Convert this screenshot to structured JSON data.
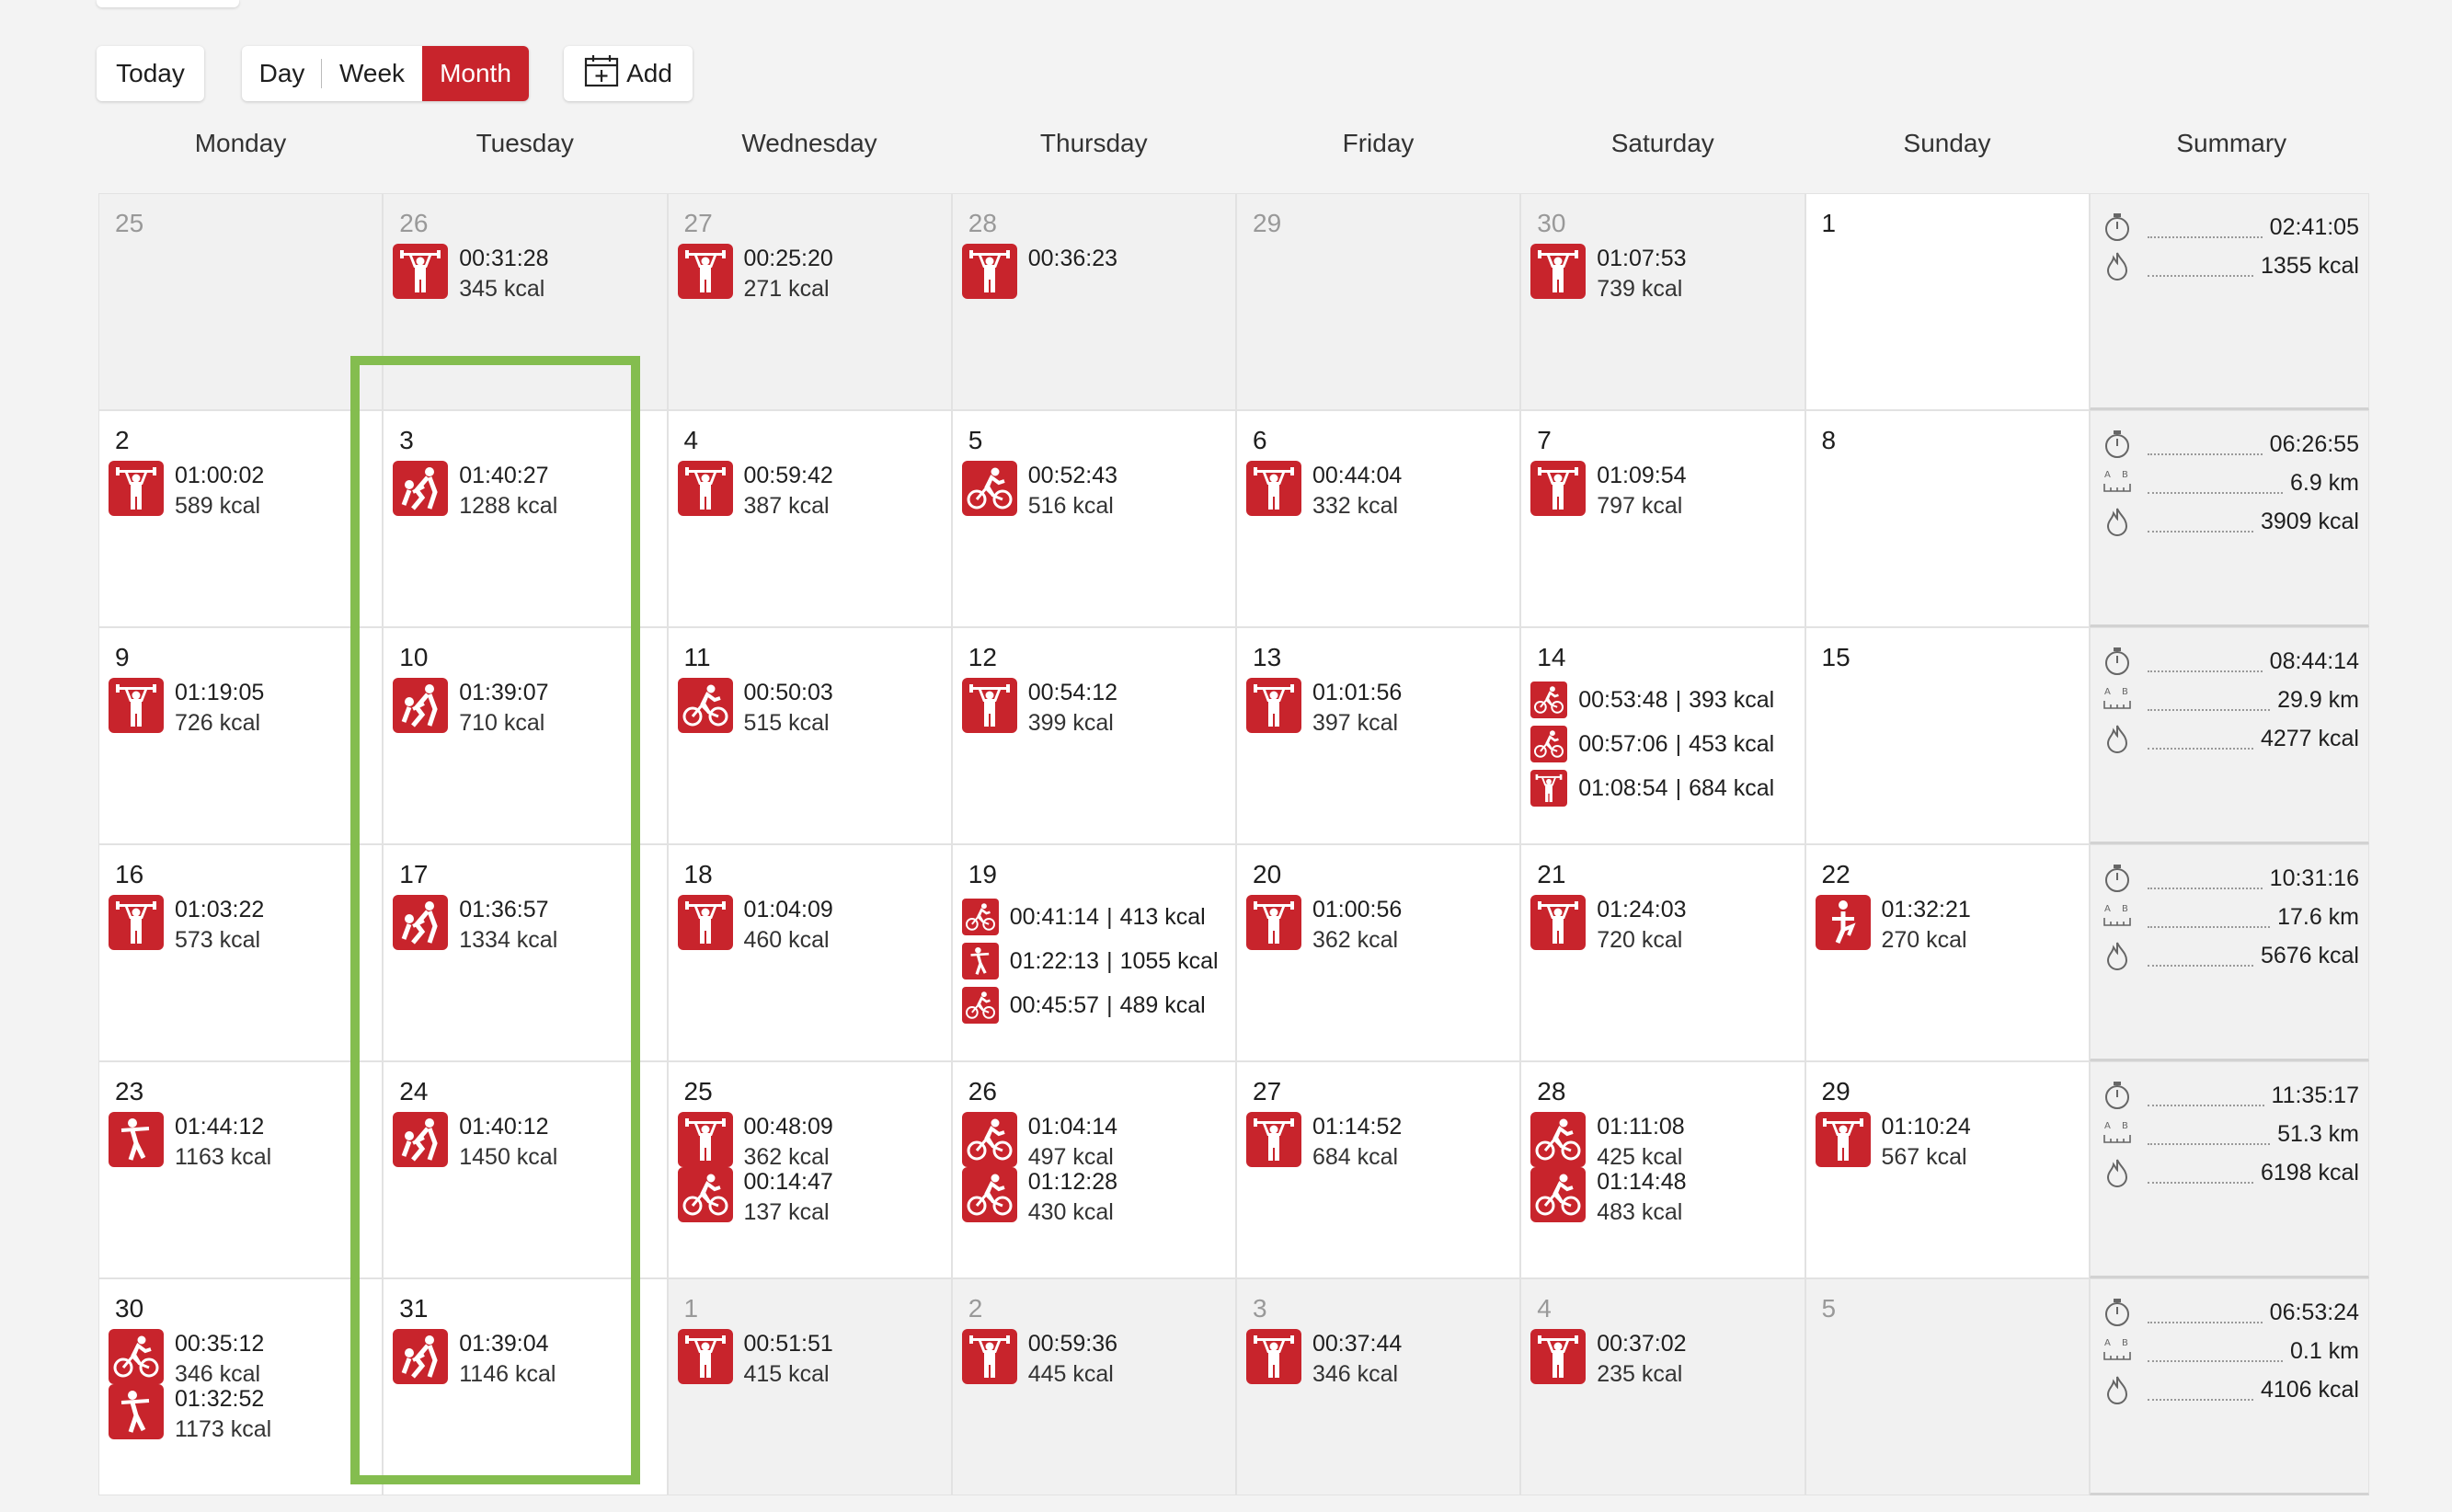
{
  "toolbar": {
    "today_label": "Today",
    "day_label": "Day",
    "week_label": "Week",
    "month_label": "Month",
    "add_label": "Add"
  },
  "weekdays": [
    "Monday",
    "Tuesday",
    "Wednesday",
    "Thursday",
    "Friday",
    "Saturday",
    "Sunday",
    "Summary"
  ],
  "colors": {
    "accent": "#c8242c",
    "highlight": "#84bd4f"
  },
  "weeks": [
    {
      "days": [
        {
          "num": "25",
          "out": true,
          "entries": []
        },
        {
          "num": "26",
          "out": true,
          "entries": [
            {
              "icon": "weightlifting-icon",
              "time": "00:31:28",
              "kcal": "345 kcal"
            }
          ]
        },
        {
          "num": "27",
          "out": true,
          "entries": [
            {
              "icon": "weightlifting-icon",
              "time": "00:25:20",
              "kcal": "271 kcal"
            }
          ]
        },
        {
          "num": "28",
          "out": true,
          "entries": [
            {
              "icon": "weightlifting-icon",
              "time": "00:36:23",
              "kcal": ""
            }
          ]
        },
        {
          "num": "29",
          "out": true,
          "entries": []
        },
        {
          "num": "30",
          "out": true,
          "entries": [
            {
              "icon": "weightlifting-icon",
              "time": "01:07:53",
              "kcal": "739 kcal"
            }
          ]
        },
        {
          "num": "1",
          "out": false,
          "entries": []
        }
      ],
      "summary": {
        "time": "02:41:05",
        "distance": "",
        "kcal": "1355 kcal"
      }
    },
    {
      "days": [
        {
          "num": "2",
          "out": false,
          "entries": [
            {
              "icon": "weightlifting-icon",
              "time": "01:00:02",
              "kcal": "589 kcal"
            }
          ]
        },
        {
          "num": "3",
          "out": false,
          "entries": [
            {
              "icon": "wrestling-icon",
              "time": "01:40:27",
              "kcal": "1288 kcal"
            }
          ]
        },
        {
          "num": "4",
          "out": false,
          "entries": [
            {
              "icon": "weightlifting-icon",
              "time": "00:59:42",
              "kcal": "387 kcal"
            }
          ]
        },
        {
          "num": "5",
          "out": false,
          "entries": [
            {
              "icon": "cycling-icon",
              "time": "00:52:43",
              "kcal": "516 kcal"
            }
          ]
        },
        {
          "num": "6",
          "out": false,
          "entries": [
            {
              "icon": "weightlifting-icon",
              "time": "00:44:04",
              "kcal": "332 kcal"
            }
          ]
        },
        {
          "num": "7",
          "out": false,
          "entries": [
            {
              "icon": "weightlifting-icon",
              "time": "01:09:54",
              "kcal": "797 kcal"
            }
          ]
        },
        {
          "num": "8",
          "out": false,
          "entries": []
        }
      ],
      "summary": {
        "time": "06:26:55",
        "distance": "6.9 km",
        "kcal": "3909 kcal"
      }
    },
    {
      "days": [
        {
          "num": "9",
          "out": false,
          "entries": [
            {
              "icon": "weightlifting-icon",
              "time": "01:19:05",
              "kcal": "726 kcal"
            }
          ]
        },
        {
          "num": "10",
          "out": false,
          "entries": [
            {
              "icon": "wrestling-icon",
              "time": "01:39:07",
              "kcal": "710 kcal"
            }
          ]
        },
        {
          "num": "11",
          "out": false,
          "entries": [
            {
              "icon": "cycling-icon",
              "time": "00:50:03",
              "kcal": "515 kcal"
            }
          ]
        },
        {
          "num": "12",
          "out": false,
          "entries": [
            {
              "icon": "weightlifting-icon",
              "time": "00:54:12",
              "kcal": "399 kcal"
            }
          ]
        },
        {
          "num": "13",
          "out": false,
          "entries": [
            {
              "icon": "weightlifting-icon",
              "time": "01:01:56",
              "kcal": "397 kcal"
            }
          ]
        },
        {
          "num": "14",
          "out": false,
          "compact": true,
          "entries": [
            {
              "icon": "cycling-icon",
              "time": "00:53:48",
              "kcal": "393 kcal"
            },
            {
              "icon": "cycling-icon",
              "time": "00:57:06",
              "kcal": "453 kcal"
            },
            {
              "icon": "weightlifting-icon",
              "time": "01:08:54",
              "kcal": "684 kcal"
            }
          ]
        },
        {
          "num": "15",
          "out": false,
          "entries": []
        }
      ],
      "summary": {
        "time": "08:44:14",
        "distance": "29.9 km",
        "kcal": "4277 kcal"
      }
    },
    {
      "days": [
        {
          "num": "16",
          "out": false,
          "entries": [
            {
              "icon": "weightlifting-icon",
              "time": "01:03:22",
              "kcal": "573 kcal"
            }
          ]
        },
        {
          "num": "17",
          "out": false,
          "entries": [
            {
              "icon": "wrestling-icon",
              "time": "01:36:57",
              "kcal": "1334 kcal"
            }
          ]
        },
        {
          "num": "18",
          "out": false,
          "entries": [
            {
              "icon": "weightlifting-icon",
              "time": "01:04:09",
              "kcal": "460 kcal"
            }
          ]
        },
        {
          "num": "19",
          "out": false,
          "compact": true,
          "entries": [
            {
              "icon": "cycling-icon",
              "time": "00:41:14",
              "kcal": "413 kcal"
            },
            {
              "icon": "golf-icon",
              "time": "01:22:13",
              "kcal": "1055 kcal"
            },
            {
              "icon": "cycling-icon",
              "time": "00:45:57",
              "kcal": "489 kcal"
            }
          ]
        },
        {
          "num": "20",
          "out": false,
          "entries": [
            {
              "icon": "weightlifting-icon",
              "time": "01:00:56",
              "kcal": "362 kcal"
            }
          ]
        },
        {
          "num": "21",
          "out": false,
          "entries": [
            {
              "icon": "weightlifting-icon",
              "time": "01:24:03",
              "kcal": "720 kcal"
            }
          ]
        },
        {
          "num": "22",
          "out": false,
          "entries": [
            {
              "icon": "yoga-icon",
              "time": "01:32:21",
              "kcal": "270 kcal"
            }
          ]
        }
      ],
      "summary": {
        "time": "10:31:16",
        "distance": "17.6 km",
        "kcal": "5676 kcal"
      }
    },
    {
      "days": [
        {
          "num": "23",
          "out": false,
          "entries": [
            {
              "icon": "golf-icon",
              "time": "01:44:12",
              "kcal": "1163 kcal"
            }
          ]
        },
        {
          "num": "24",
          "out": false,
          "entries": [
            {
              "icon": "wrestling-icon",
              "time": "01:40:12",
              "kcal": "1450 kcal"
            }
          ]
        },
        {
          "num": "25",
          "out": false,
          "entries": [
            {
              "icon": "weightlifting-icon",
              "time": "00:48:09",
              "kcal": "362 kcal"
            },
            {
              "icon": "cycling-icon",
              "time": "00:14:47",
              "kcal": "137 kcal"
            }
          ]
        },
        {
          "num": "26",
          "out": false,
          "entries": [
            {
              "icon": "cycling-icon",
              "time": "01:04:14",
              "kcal": "497 kcal"
            },
            {
              "icon": "cycling-icon",
              "time": "01:12:28",
              "kcal": "430 kcal"
            }
          ]
        },
        {
          "num": "27",
          "out": false,
          "entries": [
            {
              "icon": "weightlifting-icon",
              "time": "01:14:52",
              "kcal": "684 kcal"
            }
          ]
        },
        {
          "num": "28",
          "out": false,
          "entries": [
            {
              "icon": "cycling-icon",
              "time": "01:11:08",
              "kcal": "425 kcal"
            },
            {
              "icon": "cycling-icon",
              "time": "01:14:48",
              "kcal": "483 kcal"
            }
          ]
        },
        {
          "num": "29",
          "out": false,
          "entries": [
            {
              "icon": "weightlifting-icon",
              "time": "01:10:24",
              "kcal": "567 kcal"
            }
          ]
        }
      ],
      "summary": {
        "time": "11:35:17",
        "distance": "51.3 km",
        "kcal": "6198 kcal"
      }
    },
    {
      "days": [
        {
          "num": "30",
          "out": false,
          "entries": [
            {
              "icon": "cycling-icon",
              "time": "00:35:12",
              "kcal": "346 kcal"
            },
            {
              "icon": "golf-icon",
              "time": "01:32:52",
              "kcal": "1173 kcal"
            }
          ]
        },
        {
          "num": "31",
          "out": false,
          "entries": [
            {
              "icon": "wrestling-icon",
              "time": "01:39:04",
              "kcal": "1146 kcal"
            }
          ]
        },
        {
          "num": "1",
          "out": true,
          "entries": [
            {
              "icon": "weightlifting-icon",
              "time": "00:51:51",
              "kcal": "415 kcal"
            }
          ]
        },
        {
          "num": "2",
          "out": true,
          "entries": [
            {
              "icon": "weightlifting-icon",
              "time": "00:59:36",
              "kcal": "445 kcal"
            }
          ]
        },
        {
          "num": "3",
          "out": true,
          "entries": [
            {
              "icon": "weightlifting-icon",
              "time": "00:37:44",
              "kcal": "346 kcal"
            }
          ]
        },
        {
          "num": "4",
          "out": true,
          "entries": [
            {
              "icon": "weightlifting-icon",
              "time": "00:37:02",
              "kcal": "235 kcal"
            }
          ]
        },
        {
          "num": "5",
          "out": true,
          "entries": []
        }
      ],
      "summary": {
        "time": "06:53:24",
        "distance": "0.1 km",
        "kcal": "4106 kcal"
      }
    }
  ]
}
